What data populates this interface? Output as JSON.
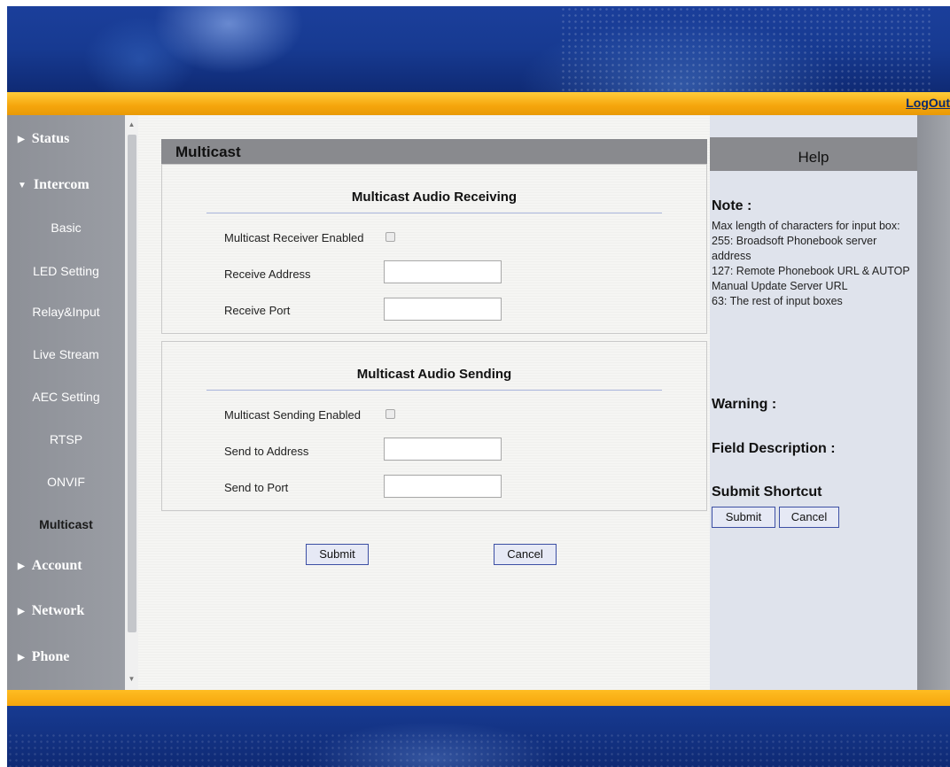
{
  "header": {
    "logout": "LogOut"
  },
  "sidebar": {
    "sections": [
      {
        "label": "Status",
        "marker": "▶"
      },
      {
        "label": "Intercom",
        "marker": "▼"
      },
      {
        "label": "Account",
        "marker": "▶"
      },
      {
        "label": "Network",
        "marker": "▶"
      },
      {
        "label": "Phone",
        "marker": "▶"
      }
    ],
    "items": [
      "Basic",
      "LED Setting",
      "Relay&Input",
      "Live Stream",
      "AEC Setting",
      "RTSP",
      "ONVIF",
      "Multicast"
    ],
    "active_item": "Multicast"
  },
  "main": {
    "title": "Multicast",
    "receiving": {
      "title": "Multicast Audio Receiving",
      "enabled_label": "Multicast Receiver Enabled",
      "enabled": false,
      "address_label": "Receive Address",
      "address_value": "",
      "port_label": "Receive Port",
      "port_value": ""
    },
    "sending": {
      "title": "Multicast Audio Sending",
      "enabled_label": "Multicast Sending Enabled",
      "enabled": false,
      "address_label": "Send to Address",
      "address_value": "",
      "port_label": "Send to Port",
      "port_value": ""
    },
    "submit_label": "Submit",
    "cancel_label": "Cancel"
  },
  "help": {
    "title": "Help",
    "note_heading": "Note :",
    "note_lines": [
      "Max length of characters for input box:",
      "255: Broadsoft Phonebook server address",
      "127: Remote Phonebook URL & AUTOP Manual Update Server URL",
      "63: The rest of input boxes"
    ],
    "warning_heading": "Warning :",
    "field_desc_heading": "Field Description :",
    "shortcut_heading": "Submit Shortcut",
    "submit_label": "Submit",
    "cancel_label": "Cancel"
  },
  "colors": {
    "banner_blue": "#173a91",
    "orange_bar": "#f5a50c",
    "sidebar_gray": "#9a9da4",
    "header_gray": "#898a8e",
    "help_bg": "#dfe3ec",
    "button_border": "#3c4fa4"
  }
}
